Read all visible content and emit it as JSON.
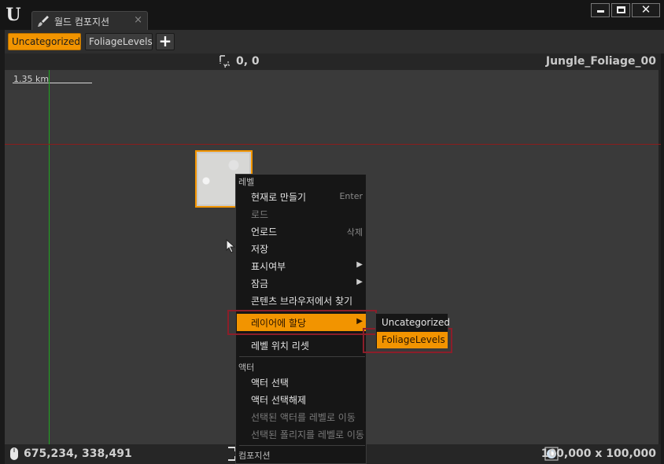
{
  "window": {
    "tab_title": "월드 컴포지션",
    "tab_close": "×",
    "close_glyph": "✕"
  },
  "toolbar": {
    "layers": [
      "Uncategorized",
      "FoliageLevels"
    ],
    "add_label": "+"
  },
  "viewport": {
    "top_coords": "0, 0",
    "level_name": "Jungle_Foliage_00",
    "scale_label": "1.35 km",
    "mouse_coords": "675,234, 338,491",
    "world_size": "100,000 x 100,000"
  },
  "context_menu": {
    "section_level": "레벨",
    "make_current": "현재로 만들기",
    "make_current_shortcut": "Enter",
    "load": "로드",
    "unload": "언로드",
    "unload_shortcut": "삭제",
    "save": "저장",
    "visibility": "표시여부",
    "lock": "잠금",
    "find_in_browser": "콘텐츠 브라우저에서 찾기",
    "assign_to_layer": "레이어에 할당",
    "reset_position": "레벨 위치 리셋",
    "section_actor": "액터",
    "select_actors": "액터 선택",
    "deselect_actors": "액터 선택해제",
    "move_actors": "선택된 액터를 레벨로 이동",
    "move_foliage": "선택된 폴리지를 레벨로 이동",
    "section_composition": "컴포지션"
  },
  "submenu": {
    "items": [
      "Uncategorized",
      "FoliageLevels"
    ]
  },
  "colors": {
    "accent": "#f29400",
    "highlight_frame": "#8b1e2a",
    "axis_green": "#1fa61f",
    "axis_red": "#8a1d1d"
  }
}
